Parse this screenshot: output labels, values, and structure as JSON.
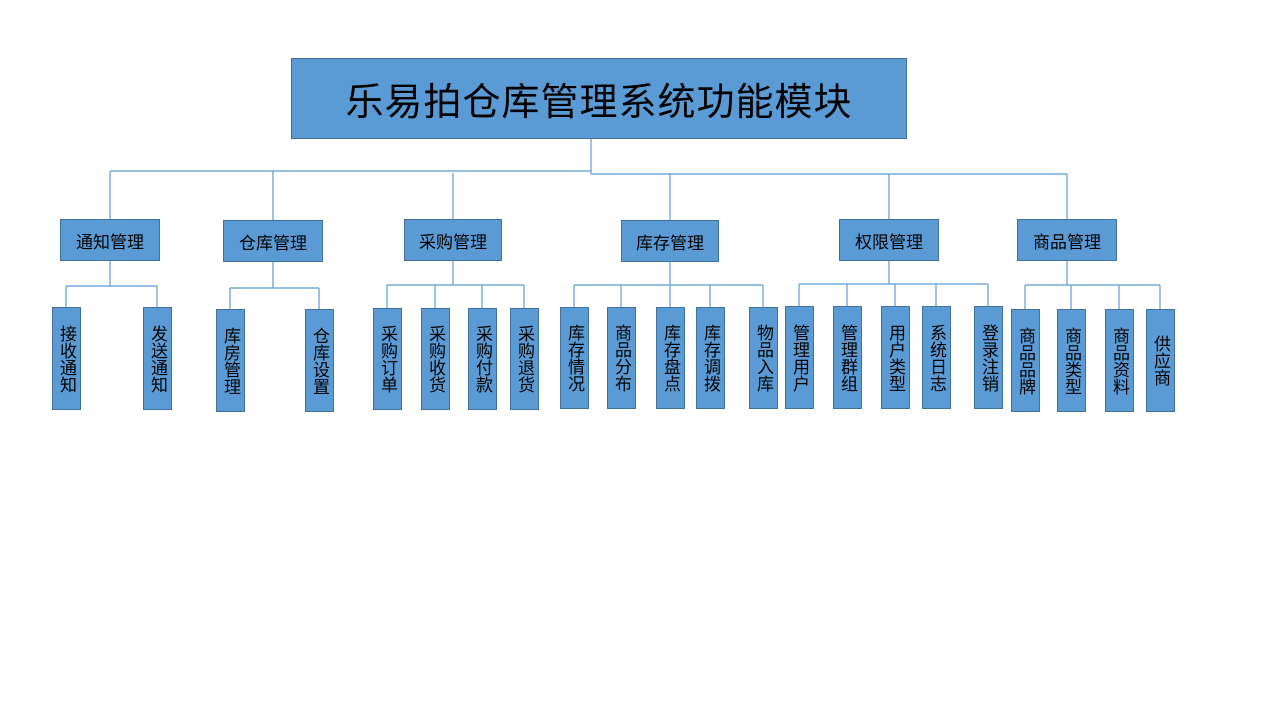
{
  "diagram": {
    "title": "乐易拍仓库管理系统功能模块",
    "categories": [
      {
        "label": "通知管理",
        "children": [
          "接收通知",
          "发送通知"
        ]
      },
      {
        "label": "仓库管理",
        "children": [
          "库房管理",
          "仓库设置"
        ]
      },
      {
        "label": "采购管理",
        "children": [
          "采购订单",
          "采购收货",
          "采购付款",
          "采购退货"
        ]
      },
      {
        "label": "库存管理",
        "children": [
          "库存情况",
          "商品分布",
          "库存盘点",
          "库存调拨",
          "物品入库"
        ]
      },
      {
        "label": "权限管理",
        "children": [
          "管理用户",
          "管理群组",
          "用户类型",
          "系统日志",
          "登录注销"
        ]
      },
      {
        "label": "商品管理",
        "children": [
          "商品品牌",
          "商品类型",
          "商品资料",
          "供应商"
        ]
      }
    ],
    "colors": {
      "box_fill": "#5b9bd5",
      "box_border": "#41719c",
      "connector": "#5b9bd5",
      "text": "#000000"
    }
  }
}
